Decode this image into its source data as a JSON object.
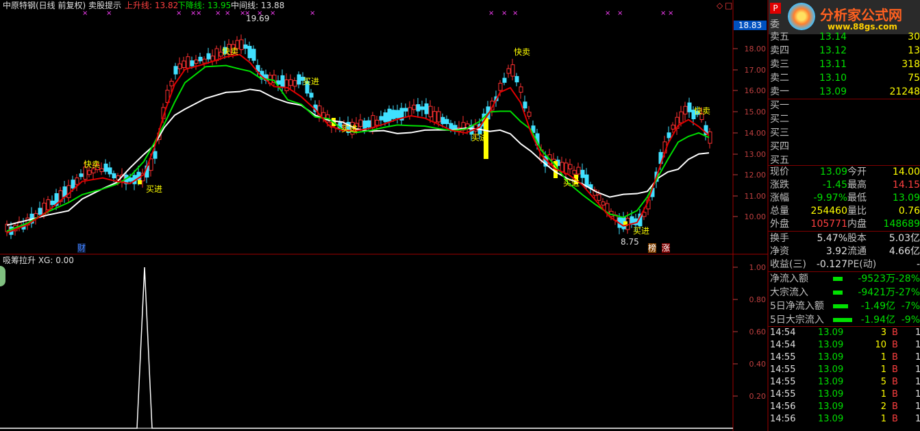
{
  "header": {
    "title": "中原特钢(日线 前复权) 卖股提示",
    "up_label": "上升线: 13.82",
    "down_label": "下降线: 13.95",
    "mid_label": "中间线: 13.88",
    "up_color": "#ff4040",
    "down_color": "#00e000"
  },
  "main_chart": {
    "annotations": {
      "high": "19.69",
      "low": "8.75",
      "sell": "快卖",
      "buy": "买进",
      "marker_cai": "财",
      "marker_bang": "榜",
      "marker_zhang": "涨"
    },
    "y_ticks": [
      "18.00",
      "17.00",
      "16.00",
      "15.00",
      "14.00",
      "13.00",
      "12.00",
      "11.00",
      "10.00"
    ],
    "current_price_tag": "18.83"
  },
  "sub_chart": {
    "title": "吸筹拉升 XG: 0.00",
    "y_ticks": [
      "1.00",
      "0.80",
      "0.60",
      "0.40",
      "0.20"
    ]
  },
  "logo": {
    "letter": "P",
    "brand": "分析家公式网",
    "url": "www.88gs.com"
  },
  "order_book": {
    "header_label": "委",
    "sells": [
      {
        "label": "卖五",
        "price": "13.14",
        "vol": "30"
      },
      {
        "label": "卖四",
        "price": "13.12",
        "vol": "13"
      },
      {
        "label": "卖三",
        "price": "13.11",
        "vol": "318"
      },
      {
        "label": "卖二",
        "price": "13.10",
        "vol": "75"
      },
      {
        "label": "卖一",
        "price": "13.09",
        "vol": "21248"
      }
    ],
    "buys": [
      {
        "label": "买一",
        "price": "",
        "vol": ""
      },
      {
        "label": "买二",
        "price": "",
        "vol": ""
      },
      {
        "label": "买三",
        "price": "",
        "vol": ""
      },
      {
        "label": "买四",
        "price": "",
        "vol": ""
      },
      {
        "label": "买五",
        "price": "",
        "vol": ""
      }
    ]
  },
  "quote": {
    "rows": [
      {
        "l1": "现价",
        "v1": "13.09",
        "l2": "今开",
        "v2": "14.00"
      },
      {
        "l1": "涨跌",
        "v1": "-1.45",
        "l2": "最高",
        "v2": "14.15"
      },
      {
        "l1": "涨幅",
        "v1": "-9.97%",
        "l2": "最低",
        "v2": "13.09"
      },
      {
        "l1": "总量",
        "v1": "254460",
        "l2": "量比",
        "v2": "0.76"
      },
      {
        "l1": "外盘",
        "v1": "105771",
        "l2": "内盘",
        "v2": "148689"
      }
    ],
    "rows2": [
      {
        "l1": "换手",
        "v1": "5.47%",
        "l2": "股本",
        "v2": "5.03亿"
      },
      {
        "l1": "净资",
        "v1": "3.92",
        "l2": "流通",
        "v2": "4.66亿"
      },
      {
        "l1": "收益(三)",
        "v1": "-0.127",
        "l2": "PE(动)",
        "v2": "-"
      }
    ]
  },
  "fund_flow": [
    {
      "label": "净流入额",
      "value": "-9523万",
      "pct": "-28%"
    },
    {
      "label": "大宗流入",
      "value": "-9421万",
      "pct": "-27%"
    },
    {
      "label": "5日净流入额",
      "value": "-1.49亿",
      "pct": "-7%"
    },
    {
      "label": "5日大宗流入",
      "value": "-1.94亿",
      "pct": "-9%"
    }
  ],
  "ticks": [
    {
      "time": "14:54",
      "price": "13.09",
      "vol": "3",
      "side": "B",
      "n": "1"
    },
    {
      "time": "14:54",
      "price": "13.09",
      "vol": "10",
      "side": "B",
      "n": "1"
    },
    {
      "time": "14:55",
      "price": "13.09",
      "vol": "1",
      "side": "B",
      "n": "1"
    },
    {
      "time": "14:55",
      "price": "13.09",
      "vol": "1",
      "side": "B",
      "n": "1"
    },
    {
      "time": "14:55",
      "price": "13.09",
      "vol": "5",
      "side": "B",
      "n": "1"
    },
    {
      "time": "14:55",
      "price": "13.09",
      "vol": "1",
      "side": "B",
      "n": "1"
    },
    {
      "time": "14:56",
      "price": "13.09",
      "vol": "2",
      "side": "B",
      "n": "1"
    },
    {
      "time": "14:56",
      "price": "13.09",
      "vol": "1",
      "side": "B",
      "n": "1"
    }
  ]
}
